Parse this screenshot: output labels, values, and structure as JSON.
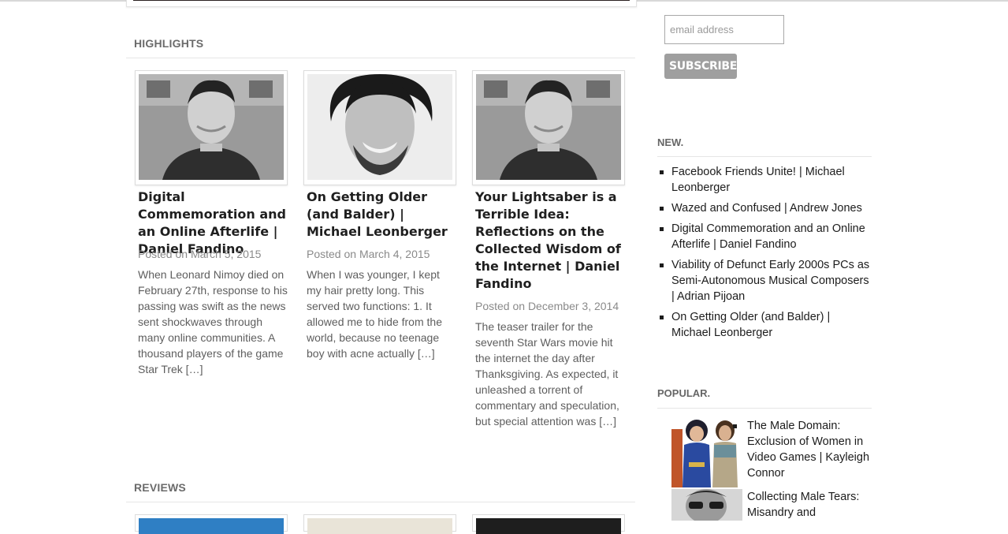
{
  "highlights": {
    "heading": "HIGHLIGHTS",
    "posts": [
      {
        "title": "Digital Commemoration and an Online Afterlife | Daniel Fandino",
        "date": "Posted on March 5, 2015",
        "excerpt": "When Leonard Nimoy died on February 27th, response to his passing was swift as the news sent shockwaves through many online communities. A thousand players of the game Star Trek […]",
        "image": "author-portrait-photo"
      },
      {
        "title": "On Getting Older (and Balder) | Michael Leonberger",
        "date": "Posted on March 4, 2015",
        "excerpt": "When I was younger, I kept my hair pretty long. This served two functions: 1. It allowed me to hide from the world, because no teenage boy with acne actually […]",
        "image": "author-portrait-photo"
      },
      {
        "title": "Your Lightsaber is a Terrible Idea: Reflections on the Collected Wisdom of the Internet | Daniel Fandino",
        "date": "Posted on December 3, 2014",
        "excerpt": "The teaser trailer for the seventh Star Wars movie hit the internet the day after Thanksgiving. As expected, it unleashed a torrent of commentary and speculation, but special attention was […]",
        "image": "author-portrait-photo"
      }
    ]
  },
  "reviews": {
    "heading": "REVIEWS"
  },
  "subscribe": {
    "email_placeholder": "email address",
    "email_value": "",
    "button_label": "SUBSCRIBE"
  },
  "sidebar": {
    "new_heading": "NEW.",
    "new_items": [
      "Facebook Friends Unite! | Michael Leonberger",
      "Wazed and Confused | Andrew Jones",
      "Digital Commemoration and an Online Afterlife | Daniel Fandino",
      "Viability of Defunct Early 2000s PCs as Semi-Autonomous Musical Composers | Adrian Pijoan",
      "On Getting Older (and Balder) | Michael Leonberger"
    ],
    "popular_heading": "POPULAR.",
    "popular_items": [
      "The Male Domain: Exclusion of Women in Video Games | Kayleigh Connor",
      "Collecting Male Tears: Misandry and"
    ]
  }
}
